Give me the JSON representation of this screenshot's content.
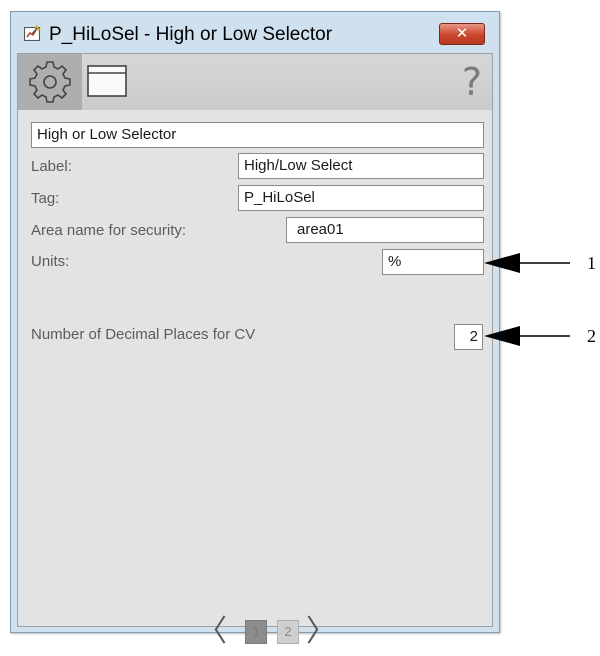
{
  "window": {
    "title": "P_HiLoSel - High or Low Selector",
    "close_label": "✕"
  },
  "toolbar": {
    "settings_icon": "gear-icon",
    "display_icon": "window-icon",
    "help_label": "?"
  },
  "form": {
    "description_value": "High or Low Selector",
    "label_caption": "Label:",
    "label_value": "High/Low Select",
    "tag_caption": "Tag:",
    "tag_value": "P_HiLoSel",
    "area_caption": "Area name for security:",
    "area_value": "area01",
    "units_caption": "Units:",
    "units_value": "%",
    "decimals_caption": "Number of Decimal Places for CV",
    "decimals_value": "2"
  },
  "pager": {
    "prev_label": "〈",
    "next_label": "〉",
    "pages": [
      "1",
      "2"
    ],
    "current_page": 1
  },
  "callouts": [
    "1",
    "2"
  ]
}
